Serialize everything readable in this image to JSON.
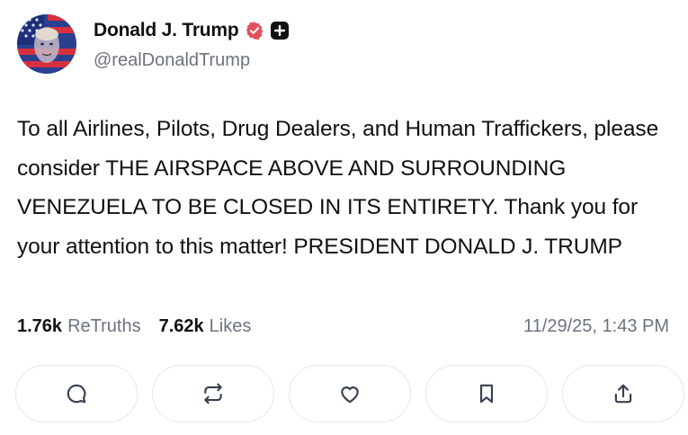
{
  "author": {
    "display_name": "Donald J. Trump",
    "handle": "@realDonaldTrump",
    "verified_icon": "verified-badge-icon",
    "extra_icon": "plus-icon",
    "verified_color": "#e44f5d"
  },
  "post": {
    "text": "To all Airlines, Pilots, Drug Dealers, and Human Traffickers, please consider THE AIRSPACE ABOVE AND SURROUNDING VENEZUELA TO BE CLOSED IN ITS ENTIRETY. Thank you for your attention to this matter! PRESIDENT DONALD J. TRUMP"
  },
  "stats": {
    "retruths_count": "1.76k",
    "retruths_label": "ReTruths",
    "likes_count": "7.62k",
    "likes_label": "Likes",
    "timestamp": "11/29/25, 1:43 PM"
  },
  "actions": [
    {
      "name": "reply",
      "icon": "comment-icon"
    },
    {
      "name": "retruth",
      "icon": "repost-icon"
    },
    {
      "name": "like",
      "icon": "heart-icon"
    },
    {
      "name": "bookmark",
      "icon": "bookmark-icon"
    },
    {
      "name": "share",
      "icon": "share-icon"
    }
  ]
}
